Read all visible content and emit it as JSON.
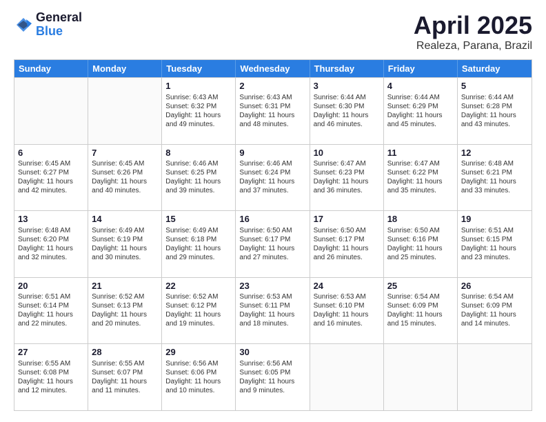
{
  "logo": {
    "general": "General",
    "blue": "Blue"
  },
  "title": {
    "month": "April 2025",
    "location": "Realeza, Parana, Brazil"
  },
  "header_days": [
    "Sunday",
    "Monday",
    "Tuesday",
    "Wednesday",
    "Thursday",
    "Friday",
    "Saturday"
  ],
  "rows": [
    [
      {
        "day": "",
        "info": ""
      },
      {
        "day": "",
        "info": ""
      },
      {
        "day": "1",
        "info": "Sunrise: 6:43 AM\nSunset: 6:32 PM\nDaylight: 11 hours and 49 minutes."
      },
      {
        "day": "2",
        "info": "Sunrise: 6:43 AM\nSunset: 6:31 PM\nDaylight: 11 hours and 48 minutes."
      },
      {
        "day": "3",
        "info": "Sunrise: 6:44 AM\nSunset: 6:30 PM\nDaylight: 11 hours and 46 minutes."
      },
      {
        "day": "4",
        "info": "Sunrise: 6:44 AM\nSunset: 6:29 PM\nDaylight: 11 hours and 45 minutes."
      },
      {
        "day": "5",
        "info": "Sunrise: 6:44 AM\nSunset: 6:28 PM\nDaylight: 11 hours and 43 minutes."
      }
    ],
    [
      {
        "day": "6",
        "info": "Sunrise: 6:45 AM\nSunset: 6:27 PM\nDaylight: 11 hours and 42 minutes."
      },
      {
        "day": "7",
        "info": "Sunrise: 6:45 AM\nSunset: 6:26 PM\nDaylight: 11 hours and 40 minutes."
      },
      {
        "day": "8",
        "info": "Sunrise: 6:46 AM\nSunset: 6:25 PM\nDaylight: 11 hours and 39 minutes."
      },
      {
        "day": "9",
        "info": "Sunrise: 6:46 AM\nSunset: 6:24 PM\nDaylight: 11 hours and 37 minutes."
      },
      {
        "day": "10",
        "info": "Sunrise: 6:47 AM\nSunset: 6:23 PM\nDaylight: 11 hours and 36 minutes."
      },
      {
        "day": "11",
        "info": "Sunrise: 6:47 AM\nSunset: 6:22 PM\nDaylight: 11 hours and 35 minutes."
      },
      {
        "day": "12",
        "info": "Sunrise: 6:48 AM\nSunset: 6:21 PM\nDaylight: 11 hours and 33 minutes."
      }
    ],
    [
      {
        "day": "13",
        "info": "Sunrise: 6:48 AM\nSunset: 6:20 PM\nDaylight: 11 hours and 32 minutes."
      },
      {
        "day": "14",
        "info": "Sunrise: 6:49 AM\nSunset: 6:19 PM\nDaylight: 11 hours and 30 minutes."
      },
      {
        "day": "15",
        "info": "Sunrise: 6:49 AM\nSunset: 6:18 PM\nDaylight: 11 hours and 29 minutes."
      },
      {
        "day": "16",
        "info": "Sunrise: 6:50 AM\nSunset: 6:17 PM\nDaylight: 11 hours and 27 minutes."
      },
      {
        "day": "17",
        "info": "Sunrise: 6:50 AM\nSunset: 6:17 PM\nDaylight: 11 hours and 26 minutes."
      },
      {
        "day": "18",
        "info": "Sunrise: 6:50 AM\nSunset: 6:16 PM\nDaylight: 11 hours and 25 minutes."
      },
      {
        "day": "19",
        "info": "Sunrise: 6:51 AM\nSunset: 6:15 PM\nDaylight: 11 hours and 23 minutes."
      }
    ],
    [
      {
        "day": "20",
        "info": "Sunrise: 6:51 AM\nSunset: 6:14 PM\nDaylight: 11 hours and 22 minutes."
      },
      {
        "day": "21",
        "info": "Sunrise: 6:52 AM\nSunset: 6:13 PM\nDaylight: 11 hours and 20 minutes."
      },
      {
        "day": "22",
        "info": "Sunrise: 6:52 AM\nSunset: 6:12 PM\nDaylight: 11 hours and 19 minutes."
      },
      {
        "day": "23",
        "info": "Sunrise: 6:53 AM\nSunset: 6:11 PM\nDaylight: 11 hours and 18 minutes."
      },
      {
        "day": "24",
        "info": "Sunrise: 6:53 AM\nSunset: 6:10 PM\nDaylight: 11 hours and 16 minutes."
      },
      {
        "day": "25",
        "info": "Sunrise: 6:54 AM\nSunset: 6:09 PM\nDaylight: 11 hours and 15 minutes."
      },
      {
        "day": "26",
        "info": "Sunrise: 6:54 AM\nSunset: 6:09 PM\nDaylight: 11 hours and 14 minutes."
      }
    ],
    [
      {
        "day": "27",
        "info": "Sunrise: 6:55 AM\nSunset: 6:08 PM\nDaylight: 11 hours and 12 minutes."
      },
      {
        "day": "28",
        "info": "Sunrise: 6:55 AM\nSunset: 6:07 PM\nDaylight: 11 hours and 11 minutes."
      },
      {
        "day": "29",
        "info": "Sunrise: 6:56 AM\nSunset: 6:06 PM\nDaylight: 11 hours and 10 minutes."
      },
      {
        "day": "30",
        "info": "Sunrise: 6:56 AM\nSunset: 6:05 PM\nDaylight: 11 hours and 9 minutes."
      },
      {
        "day": "",
        "info": ""
      },
      {
        "day": "",
        "info": ""
      },
      {
        "day": "",
        "info": ""
      }
    ]
  ]
}
